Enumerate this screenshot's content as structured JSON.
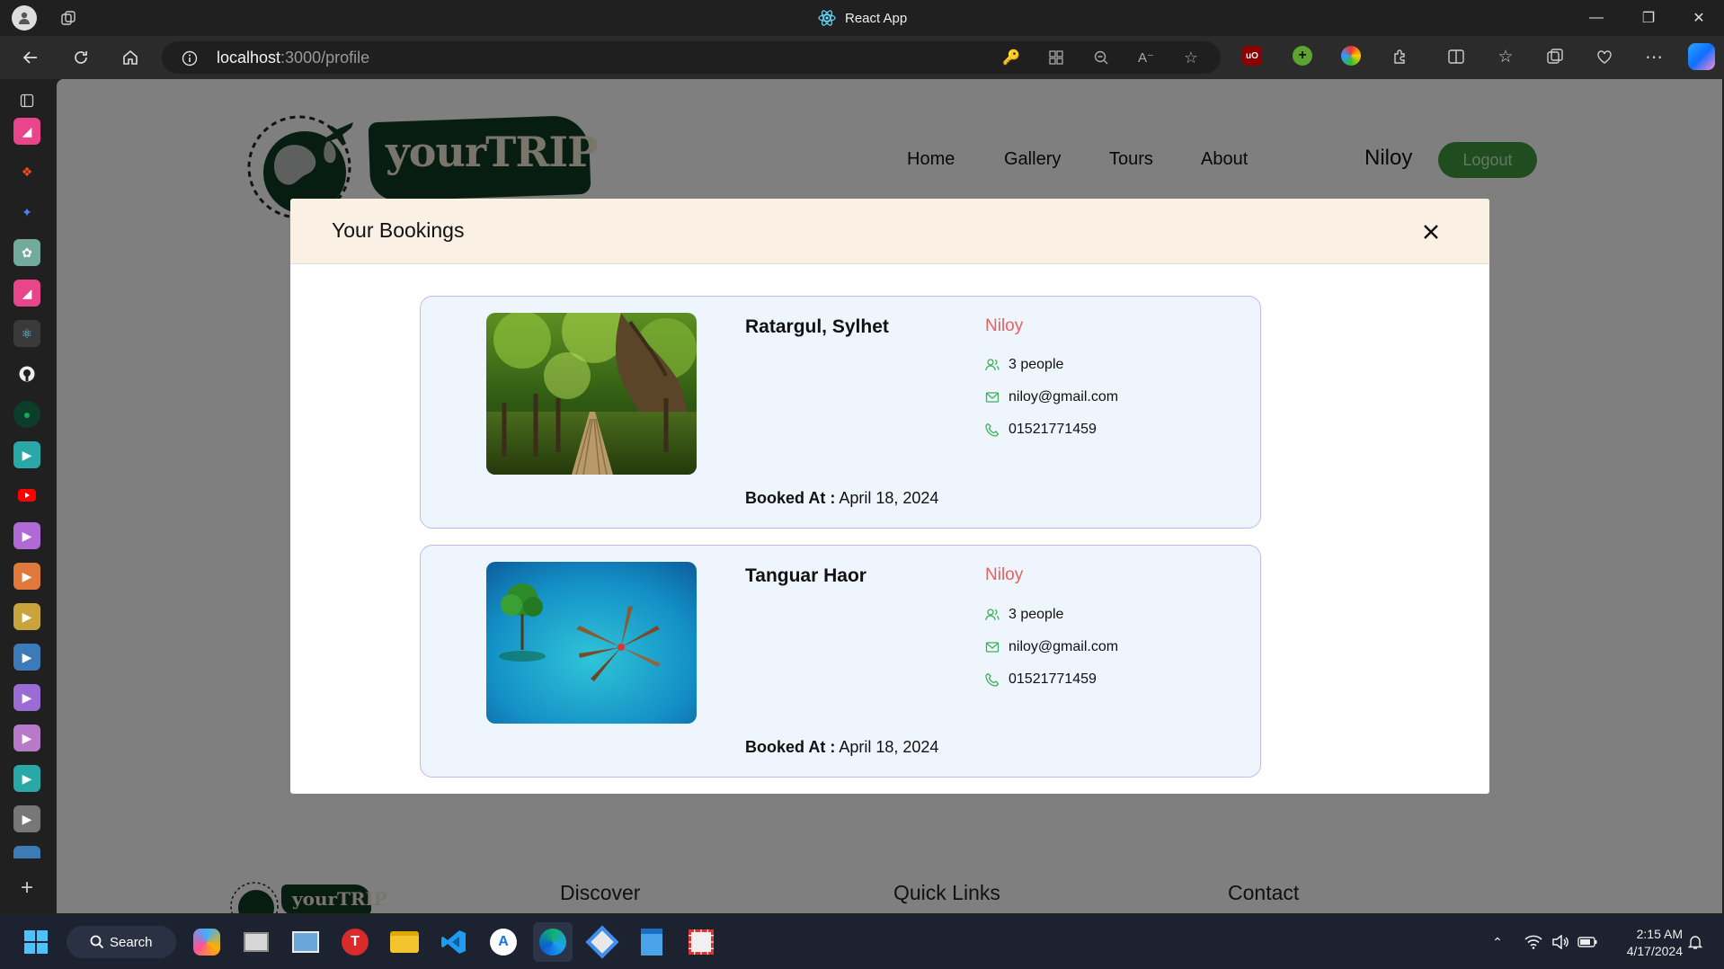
{
  "window": {
    "title": "React App"
  },
  "browser": {
    "url_host": "localhost",
    "url_rest": ":3000/profile"
  },
  "site": {
    "logo_text": "yourTRIP",
    "nav": [
      "Home",
      "Gallery",
      "Tours",
      "About"
    ],
    "user_name": "Niloy",
    "logout_label": "Logout"
  },
  "modal": {
    "title": "Your Bookings",
    "booked_label": "Booked At :",
    "bookings": [
      {
        "place": "Ratargul, Sylhet",
        "name": "Niloy",
        "people": "3 people",
        "email": "niloy@gmail.com",
        "phone": "01521771459",
        "date": "April 18, 2024"
      },
      {
        "place": "Tanguar Haor",
        "name": "Niloy",
        "people": "3 people",
        "email": "niloy@gmail.com",
        "phone": "01521771459",
        "date": "April 18, 2024"
      }
    ]
  },
  "footer": {
    "logo_text": "yourTRIP",
    "headings": [
      "Discover",
      "Quick Links",
      "Contact"
    ]
  },
  "taskbar": {
    "search_label": "Search",
    "time": "2:15 AM",
    "date": "4/17/2024"
  },
  "colors": {
    "accent_green": "#3f9a3f",
    "modal_header": "#faf1e4",
    "card_bg": "#eef5fd",
    "card_border": "#c2b8ec",
    "name_red": "#e86060"
  }
}
